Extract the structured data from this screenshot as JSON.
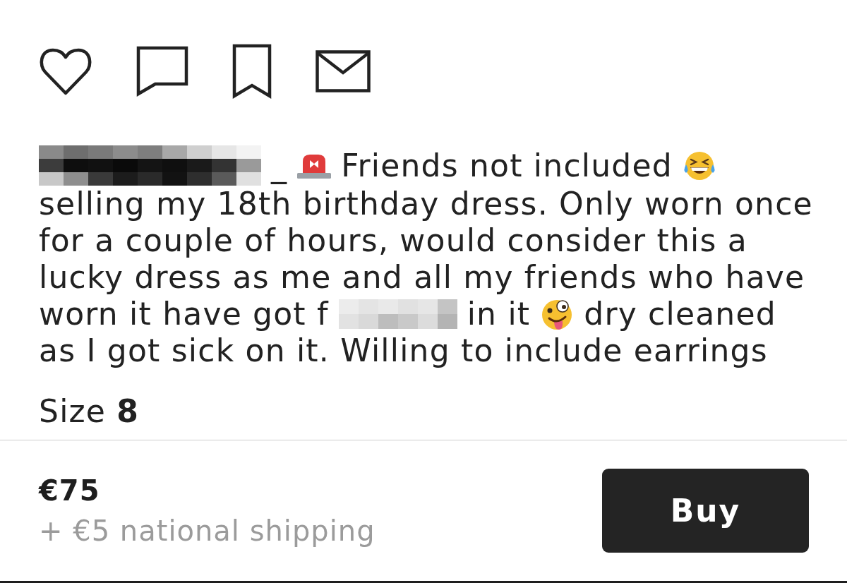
{
  "listing": {
    "description_lines": [
      {
        "segments": [
          {
            "kind": "redaction"
          },
          {
            "kind": "text",
            "text": "_"
          },
          {
            "kind": "emoji"
          },
          {
            "kind": "text",
            "text": "Friends not included"
          },
          {
            "kind": "emoji"
          }
        ]
      },
      {
        "segments": [
          {
            "kind": "text",
            "text": "selling my 18th birthday dress. Only worn once"
          }
        ]
      },
      {
        "segments": [
          {
            "kind": "text",
            "text": "for a couple of hours, would consider this a"
          }
        ]
      },
      {
        "segments": [
          {
            "kind": "text",
            "text": "lucky dress as me and all my friends who have"
          }
        ]
      },
      {
        "segments": [
          {
            "kind": "text",
            "text": "worn it have got f"
          },
          {
            "kind": "redaction"
          },
          {
            "kind": "text",
            "text": "in it"
          },
          {
            "kind": "emoji"
          },
          {
            "kind": "text",
            "text": "dry cleaned"
          }
        ]
      },
      {
        "segments": [
          {
            "kind": "text",
            "text": "as I got sick on it. Willing to include earrings"
          }
        ]
      }
    ],
    "size": "Size **8**"
  },
  "purchase_bar": {
    "price": "€75",
    "shipping": "+ €5 national shipping",
    "buy_button": "Buy"
  }
}
